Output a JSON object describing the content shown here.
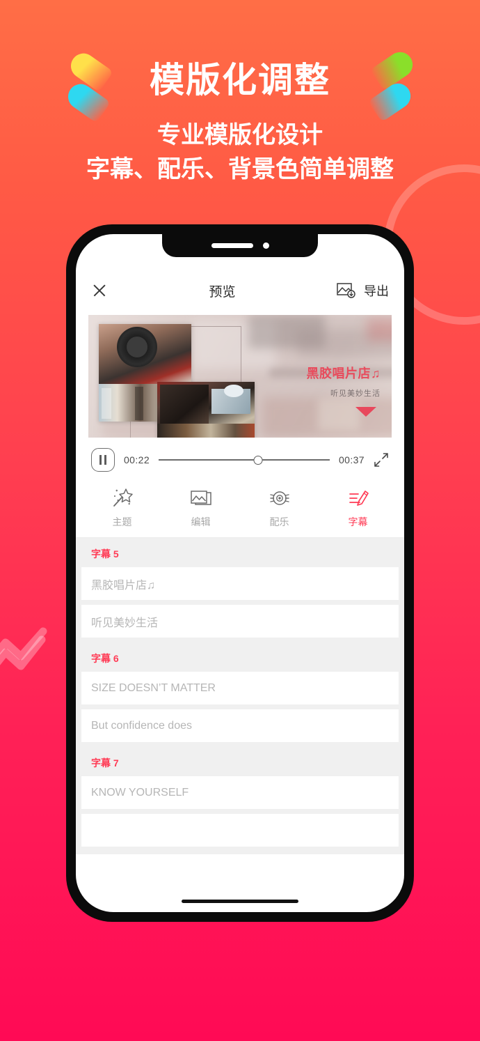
{
  "promo": {
    "title": "模版化调整",
    "subtitle_line1": "专业模版化设计",
    "subtitle_line2": "字幕、配乐、背景色简单调整"
  },
  "colors": {
    "accent_red": "#FF3B55",
    "bg_top": "#FF6E46",
    "bg_bottom": "#FF0A55",
    "blob_yellow": "#FFE04A",
    "blob_cyan": "#2ED8F0",
    "blob_green": "#8ADF2A"
  },
  "app": {
    "header": {
      "close_icon": "close-icon",
      "title": "预览",
      "export_icon": "image-download-icon",
      "export_label": "导出"
    },
    "preview": {
      "overlay_title": "黑胶唱片店♫",
      "overlay_subtitle": "听见美妙生活",
      "marker_icon": "triangle-down-icon"
    },
    "player": {
      "play_state_icon": "pause-icon",
      "current_time": "00:22",
      "total_time": "00:37",
      "progress_percent": 58,
      "fullscreen_icon": "expand-icon"
    },
    "tabs": [
      {
        "label": "主题",
        "icon": "magic-wand-icon",
        "active": false
      },
      {
        "label": "编辑",
        "icon": "images-icon",
        "active": false
      },
      {
        "label": "配乐",
        "icon": "vinyl-disc-icon",
        "active": false
      },
      {
        "label": "字幕",
        "icon": "subtitle-pencil-icon",
        "active": true
      }
    ],
    "subtitle_groups": [
      {
        "heading": "字幕 5",
        "fields": [
          {
            "value": "黑胶唱片店♫",
            "placeholder": "黑胶唱片店♫"
          },
          {
            "value": "听见美妙生活",
            "placeholder": "听见美妙生活"
          }
        ]
      },
      {
        "heading": "字幕 6",
        "fields": [
          {
            "value": "SIZE DOESN’T MATTER",
            "placeholder": "SIZE DOESN’T MATTER"
          },
          {
            "value": "But confidence does",
            "placeholder": "But confidence does"
          }
        ]
      },
      {
        "heading": "字幕 7",
        "fields": [
          {
            "value": "KNOW YOURSELF",
            "placeholder": "KNOW YOURSELF"
          },
          {
            "value": "",
            "placeholder": ""
          }
        ]
      }
    ]
  }
}
